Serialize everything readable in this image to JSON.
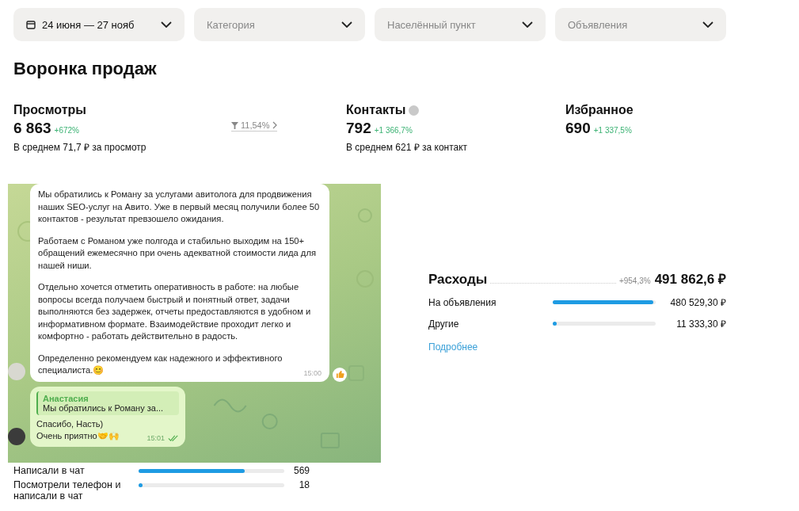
{
  "filters": [
    {
      "kind": "date",
      "label": "24 июня — 27 нояб"
    },
    {
      "kind": "select",
      "placeholder": "Категория"
    },
    {
      "kind": "select",
      "placeholder": "Населённый пункт"
    },
    {
      "kind": "select",
      "placeholder": "Объявления"
    }
  ],
  "title": "Воронка продаж",
  "metrics": [
    {
      "label": "Просмотры",
      "value": "6 863",
      "change": "+672%",
      "note": "В среднем 71,7 ₽ за просмотр",
      "conversion": "11,54%"
    },
    {
      "label": "Контакты",
      "help": true,
      "value": "792",
      "change": "+1 366,7%",
      "note": "В среднем 621 ₽ за контакт"
    },
    {
      "label": "Избранное",
      "value": "690",
      "change": "+1 337,5%"
    }
  ],
  "chat": {
    "messages": [
      {
        "kind": "incoming",
        "paragraphs": [
          "Мы обратились к Роману за услугами авитолога для продвижения наших SEO-услуг на Авито. Уже в первый месяц получили более 50 контактов - результат превзошело ожидания.",
          "Работаем с Романом уже полгода и стабильно выходим на 150+ обращений ежемесячно при очень адекватной стоимости лида для нашей ниши.",
          "Отдельно хочется отметить оперативность в работе: на любые вопросы всегда получаем быстрый и понятный ответ, задачи выполняются без задержек, отчеты предоставляются в удобном и информативном формате. Взаимодействие проходит легко и комфортно - работать  действительно в радость.",
          "Определенно  рекомендуем как надежного и эффективного специалиста.😊"
        ],
        "time": "15:00",
        "reaction": true
      },
      {
        "kind": "outgoing",
        "reply_name": "Анастасия",
        "reply_text": "Мы обратились к Роману за...",
        "paragraphs": [
          "Спасибо, Насть)",
          "Очень приятно🤝🙌"
        ],
        "time": "15:01",
        "read": true
      }
    ]
  },
  "funnel": [
    {
      "label": "Написали в чат",
      "level": 0.73,
      "value": "569"
    },
    {
      "label": "Посмотрели телефон и написали в чат",
      "level": 0.02,
      "value": "18"
    }
  ],
  "expenses": {
    "title": "Расходы",
    "change": "+954,3%",
    "total": "491 862,6 ₽",
    "rows": [
      {
        "label": "На объявления",
        "level": 0.98,
        "value": "480 529,30 ₽"
      },
      {
        "label": "Другие",
        "level": 0.03,
        "value": "11 333,30 ₽"
      }
    ],
    "link": "Подробнее"
  }
}
